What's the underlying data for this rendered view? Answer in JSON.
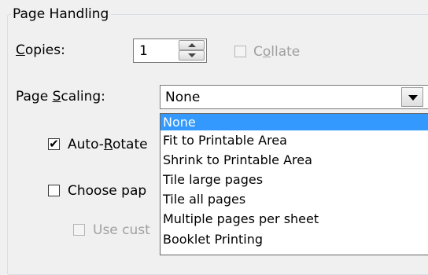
{
  "group": {
    "title": "Page Handling"
  },
  "copies": {
    "label_prefix": "",
    "label_mnemonic": "C",
    "label_rest": "opies:",
    "value": "1"
  },
  "collate": {
    "label_prefix": "C",
    "label_mnemonic": "o",
    "label_rest": "llate",
    "checked": false,
    "enabled": false
  },
  "page_scaling": {
    "label_prefix": "Page ",
    "label_mnemonic": "S",
    "label_rest": "caling:",
    "value": "None",
    "options": [
      "None",
      "Fit to Printable Area",
      "Shrink to Printable Area",
      "Tile large pages",
      "Tile all pages",
      "Multiple pages per sheet",
      "Booklet Printing"
    ],
    "selected_index": 0
  },
  "auto_rotate": {
    "label_prefix": "Auto-",
    "label_mnemonic": "R",
    "label_rest": "otate",
    "checked": true,
    "check_glyph": "✔"
  },
  "choose_paper": {
    "label_visible": "Choose pap",
    "checked": false
  },
  "use_custom": {
    "label_visible": "Use cust",
    "checked": false,
    "enabled": false
  },
  "colors": {
    "selection": "#3399ff",
    "disabled_text": "#a0a0a0",
    "window_bg": "#f0f0f0"
  }
}
